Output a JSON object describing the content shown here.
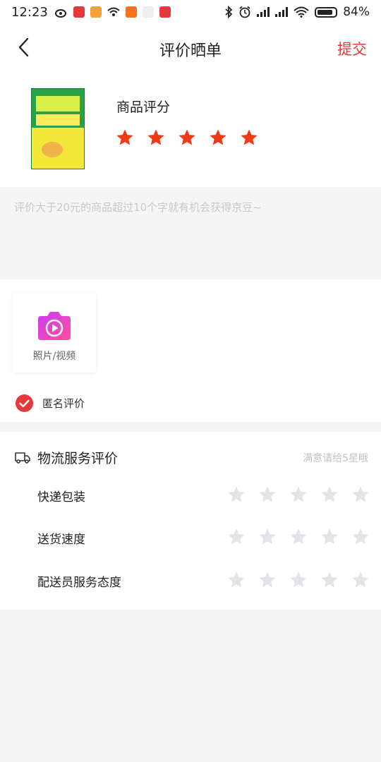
{
  "status_bar": {
    "time": "12:23",
    "battery": "84%"
  },
  "header": {
    "title": "评价晒单",
    "submit_label": "提交"
  },
  "product": {
    "rating_label": "商品评分",
    "rating": 5,
    "star_color": "#f03a17"
  },
  "comment": {
    "placeholder": "评价大于20元的商品超过10个字就有机会获得京豆~"
  },
  "media": {
    "upload_label": "照片/视频",
    "anonymous_label": "匿名评价",
    "anonymous_checked": true
  },
  "logistics": {
    "title": "物流服务评价",
    "hint": "满意请给5星哦",
    "items": [
      {
        "label": "快递包装",
        "rating": 0
      },
      {
        "label": "送货速度",
        "rating": 0
      },
      {
        "label": "配送员服务态度",
        "rating": 0
      }
    ]
  },
  "colors": {
    "accent": "#e4393c",
    "star_empty": "#e3e3e8",
    "camera_gradient_start": "#c93df2",
    "camera_gradient_end": "#ff4fa0"
  }
}
